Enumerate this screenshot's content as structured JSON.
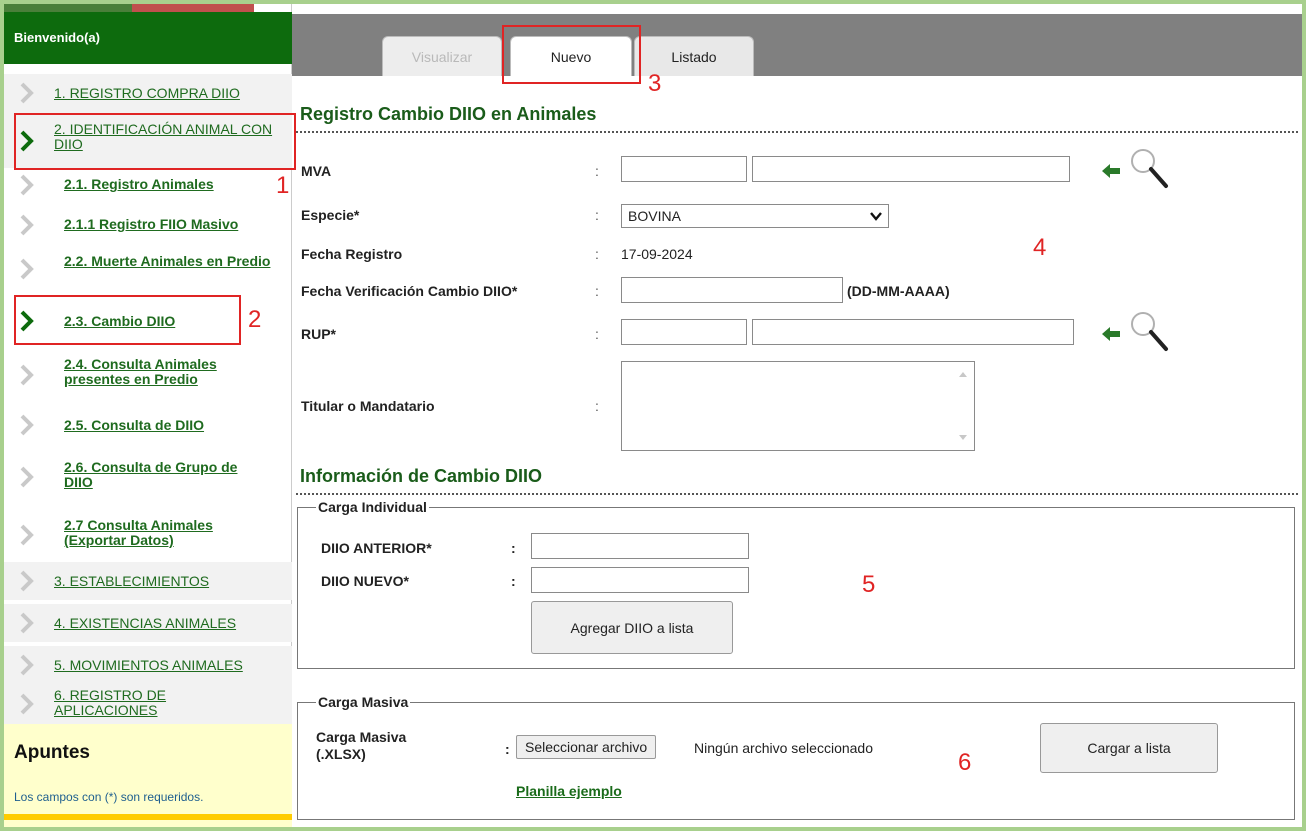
{
  "sidebar": {
    "welcome": "Bienvenido(a)",
    "items": [
      {
        "label": "1. REGISTRO COMPRA DIIO"
      },
      {
        "label": "2. IDENTIFICACIÓN ANIMAL CON DIIO"
      },
      {
        "label": "2.1. Registro Animales"
      },
      {
        "label": "2.1.1 Registro FIIO Masivo"
      },
      {
        "label": "2.2. Muerte Animales en Predio"
      },
      {
        "label": "2.3. Cambio DIIO"
      },
      {
        "label": "2.4. Consulta Animales presentes en Predio"
      },
      {
        "label": "2.5. Consulta de DIIO"
      },
      {
        "label": "2.6. Consulta de Grupo de DIIO"
      },
      {
        "label": "2.7 Consulta Animales (Exportar Datos)"
      },
      {
        "label": "3. ESTABLECIMIENTOS"
      },
      {
        "label": "4. EXISTENCIAS ANIMALES"
      },
      {
        "label": "5. MOVIMIENTOS ANIMALES"
      },
      {
        "label": "6. REGISTRO DE APLICACIONES"
      }
    ],
    "apuntes_title": "Apuntes",
    "apuntes_note": "Los campos con (*) son requeridos."
  },
  "tabs": [
    {
      "label": "Visualizar",
      "state": "disabled"
    },
    {
      "label": "Nuevo",
      "state": "active"
    },
    {
      "label": "Listado",
      "state": "normal"
    }
  ],
  "form": {
    "title": "Registro Cambio DIIO en Animales",
    "mva_label": "MVA",
    "especie_label": "Especie*",
    "especie_value": "BOVINA",
    "fecha_registro_label": "Fecha Registro",
    "fecha_registro_value": "17-09-2024",
    "fecha_verif_label": "Fecha Verificación Cambio DIIO*",
    "fecha_verif_format": "(DD-MM-AAAA)",
    "rup_label": "RUP*",
    "titular_label": "Titular o Mandatario",
    "colon": ":"
  },
  "info": {
    "title": "Información de Cambio DIIO",
    "individual_legend": "Carga Individual",
    "diio_anterior_label": "DIIO ANTERIOR*",
    "diio_nuevo_label": "DIIO NUEVO*",
    "agregar_button": "Agregar DIIO a lista",
    "masiva_legend": "Carga Masiva",
    "carga_masiva_label_1": "Carga Masiva",
    "carga_masiva_label_2": "(.XLSX)",
    "file_button": "Seleccionar archivo",
    "file_status": "Ningún archivo seleccionado",
    "cargar_button": "Cargar a lista",
    "planilla_link": "Planilla ejemplo"
  },
  "annotations": [
    "1",
    "2",
    "3",
    "4",
    "5",
    "6"
  ],
  "colors": {
    "accent_green": "#0d6b0d",
    "link_green": "#1f6b1f",
    "annotation_red": "#e02424",
    "frame_green": "#a8d08d"
  }
}
